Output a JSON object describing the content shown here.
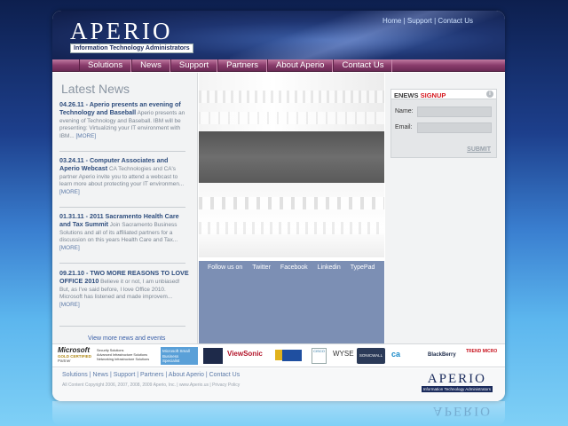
{
  "brand": {
    "name": "APERIO",
    "tagline": "Information Technology Administrators"
  },
  "top_links": [
    "Home",
    "Support",
    "Contact Us"
  ],
  "nav": [
    "Solutions",
    "News",
    "Support",
    "Partners",
    "About Aperio",
    "Contact Us"
  ],
  "news": {
    "title": "Latest News",
    "items": [
      {
        "date_title": "04.26.11 - Aperio presents an evening of Technology and Baseball",
        "body": " Aperio presents an evening of Technology and Baseball. IBM will be presenting: Virtualizing your IT environment with IBM...",
        "more": "[MORE]"
      },
      {
        "date_title": "03.24.11 - Computer Associates and Aperio Webcast",
        "body": " CA Technologies and CA's partner Aperio invite you to attend a webcast to learn more about protecting your IT environmen...",
        "more": "[MORE]"
      },
      {
        "date_title": "01.31.11 - 2011 Sacramento Health Care and Tax Summit",
        "body": " Join Sacramento Business Solutions and all of its affiliated partners for a discussion on this years Health Care and Tax...",
        "more": "[MORE]"
      },
      {
        "date_title": "09.21.10 - TWO MORE REASONS TO LOVE OFFICE 2010",
        "body": " Believe it or not, I am unbiased! But, as I've said before, I love Office 2010. Microsoft has listened and made improvem...",
        "more": "[MORE]"
      }
    ],
    "view_more": "View more news and events"
  },
  "follow": {
    "label": "Follow us on",
    "links": [
      "Twitter",
      "Facebook",
      "Linkedin",
      "TypePad"
    ]
  },
  "enews": {
    "title_a": "ENEWS",
    "title_b": "SIGNUP",
    "info": "i",
    "name_label": "Name:",
    "email_label": "Email:",
    "submit": "SUBMIT"
  },
  "partners": {
    "microsoft": "Microsoft",
    "microsoft_sub": "GOLD CERTIFIED",
    "microsoft_partner": "Partner",
    "solutions": [
      "Security Solutions",
      "Advanced Infrastructure Solutions",
      "Networking Infrastructure Solutions"
    ],
    "ms_small_biz": "Microsoft Small Business Specialist",
    "viewsonic": "ViewSonic",
    "cisco": "CISCO",
    "wyse": "WYSE",
    "sonicwall": "SONICWALL",
    "ca": "ca",
    "blackberry": "BlackBerry",
    "trend": "TREND MICRO"
  },
  "footer": {
    "links": [
      "Solutions",
      "News",
      "Support",
      "Partners",
      "About Aperio",
      "Contact Us"
    ],
    "copyright": "All Content Copyright 2006, 2007, 2008, 2009 Aperio, Inc. | www.Aperio.us | Privacy Policy"
  },
  "colors": {
    "nav": "#8a3c6c",
    "accent_red": "#d4151c",
    "link": "#3a5fa8",
    "follow_bg": "#7c8fb4"
  }
}
